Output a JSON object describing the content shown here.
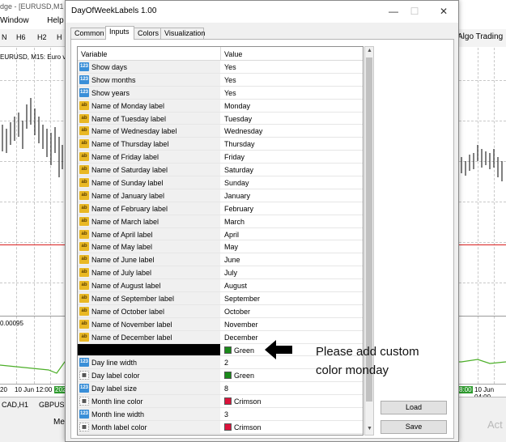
{
  "background": {
    "title_fragment": "dge - [EURUSD,M1",
    "menu": [
      "Window",
      "Help"
    ],
    "timeframes": [
      "N",
      "H6",
      "H2",
      "H"
    ],
    "algo_trading": "Algo Trading",
    "symbol_label": "EURUSD, M15:  Euro v",
    "indicator_value": "0.00095",
    "time_labels": [
      "20",
      "10 Jun 12:00",
      "10 Jun 04:00"
    ],
    "time_badges": [
      "202",
      "8:00"
    ],
    "bottom_tabs": [
      "CAD,H1",
      "GBPUSD"
    ],
    "bottom_fragments": [
      "Me",
      "Act"
    ]
  },
  "dialog": {
    "title": "DayOfWeekLabels 1.00",
    "tabs": [
      {
        "label": "Common",
        "active": false
      },
      {
        "label": "Inputs",
        "active": true
      },
      {
        "label": "Colors",
        "active": false
      },
      {
        "label": "Visualization",
        "active": false
      }
    ],
    "columns": {
      "variable": "Variable",
      "value": "Value"
    },
    "rows": [
      {
        "icon": "num",
        "icon_text": "123",
        "name": "Show days",
        "value": "Yes"
      },
      {
        "icon": "num",
        "icon_text": "123",
        "name": "Show months",
        "value": "Yes"
      },
      {
        "icon": "num",
        "icon_text": "123",
        "name": "Show years",
        "value": "Yes"
      },
      {
        "icon": "str",
        "icon_text": "ab",
        "name": "Name of Monday label",
        "value": "Monday"
      },
      {
        "icon": "str",
        "icon_text": "ab",
        "name": "Name of Tuesday label",
        "value": "Tuesday"
      },
      {
        "icon": "str",
        "icon_text": "ab",
        "name": "Name of Wednesday label",
        "value": "Wednesday"
      },
      {
        "icon": "str",
        "icon_text": "ab",
        "name": "Name of Thursday label",
        "value": "Thursday"
      },
      {
        "icon": "str",
        "icon_text": "ab",
        "name": "Name of Friday label",
        "value": "Friday"
      },
      {
        "icon": "str",
        "icon_text": "ab",
        "name": "Name of Saturday label",
        "value": "Saturday"
      },
      {
        "icon": "str",
        "icon_text": "ab",
        "name": "Name of Sunday label",
        "value": "Sunday"
      },
      {
        "icon": "str",
        "icon_text": "ab",
        "name": "Name of January label",
        "value": "January"
      },
      {
        "icon": "str",
        "icon_text": "ab",
        "name": "Name of February label",
        "value": "February"
      },
      {
        "icon": "str",
        "icon_text": "ab",
        "name": "Name of March label",
        "value": "March"
      },
      {
        "icon": "str",
        "icon_text": "ab",
        "name": "Name of April label",
        "value": "April"
      },
      {
        "icon": "str",
        "icon_text": "ab",
        "name": "Name of May label",
        "value": "May"
      },
      {
        "icon": "str",
        "icon_text": "ab",
        "name": "Name of June label",
        "value": "June"
      },
      {
        "icon": "str",
        "icon_text": "ab",
        "name": "Name of July label",
        "value": "July"
      },
      {
        "icon": "str",
        "icon_text": "ab",
        "name": "Name of August label",
        "value": "August"
      },
      {
        "icon": "str",
        "icon_text": "ab",
        "name": "Name of September label",
        "value": "September"
      },
      {
        "icon": "str",
        "icon_text": "ab",
        "name": "Name of October label",
        "value": "October"
      },
      {
        "icon": "str",
        "icon_text": "ab",
        "name": "Name of November label",
        "value": "November"
      },
      {
        "icon": "str",
        "icon_text": "ab",
        "name": "Name of December label",
        "value": "December"
      },
      {
        "icon": "none",
        "icon_text": "",
        "name": "",
        "value": "Green",
        "swatch": "#1a8a1a",
        "blacked_out": true
      },
      {
        "icon": "num",
        "icon_text": "123",
        "name": "Day line width",
        "value": "2"
      },
      {
        "icon": "clr",
        "icon_text": "▦",
        "name": "Day label color",
        "value": "Green",
        "swatch": "#1a8a1a"
      },
      {
        "icon": "num",
        "icon_text": "123",
        "name": "Day label size",
        "value": "8"
      },
      {
        "icon": "clr",
        "icon_text": "▦",
        "name": "Month line color",
        "value": "Crimson",
        "swatch": "#dc143c"
      },
      {
        "icon": "num",
        "icon_text": "123",
        "name": "Month line width",
        "value": "3"
      },
      {
        "icon": "clr",
        "icon_text": "▦",
        "name": "Month label color",
        "value": "Crimson",
        "swatch": "#dc143c"
      }
    ],
    "buttons": {
      "load": "Load",
      "save": "Save"
    }
  },
  "annotation": {
    "text_line1": "Please add custom",
    "text_line2": "color monday"
  }
}
